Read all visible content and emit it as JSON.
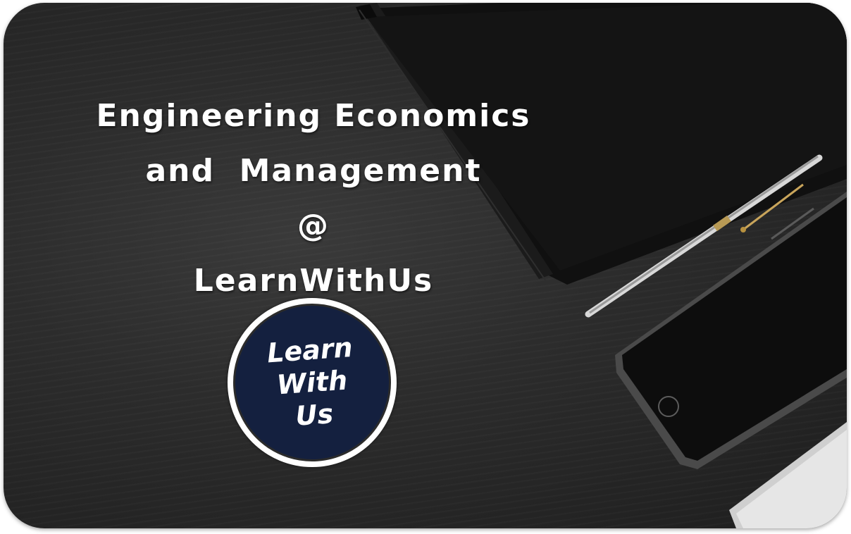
{
  "headline": {
    "line1": "Engineering Economics",
    "line2": "and  Management",
    "line3": "@",
    "line4": "LearnWithUs"
  },
  "logo": {
    "line1": "Learn",
    "line2": "With",
    "line3": "Us"
  },
  "colors": {
    "background": "#2a2a2a",
    "text": "#ffffff",
    "logo_fill": "#14203f",
    "logo_ring": "#ffffff"
  },
  "decorations": [
    "notebook",
    "pen",
    "smartphone",
    "laptop-corner"
  ]
}
